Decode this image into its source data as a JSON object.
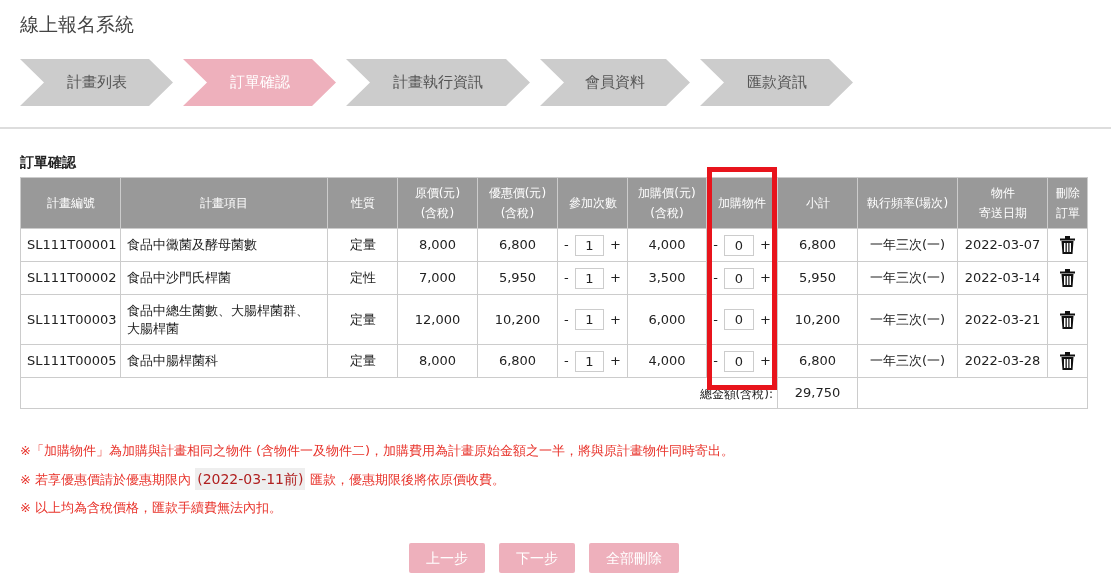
{
  "title": "線上報名系統",
  "steps": [
    {
      "label": "計畫列表",
      "selected": false
    },
    {
      "label": "訂單確認",
      "selected": true
    },
    {
      "label": "計畫執行資訊",
      "selected": false
    },
    {
      "label": "會員資料",
      "selected": false
    },
    {
      "label": "匯款資訊",
      "selected": false
    }
  ],
  "section_title": "訂單確認",
  "table": {
    "columns": [
      {
        "lines": [
          "計畫編號"
        ],
        "highlighted": false
      },
      {
        "lines": [
          "計畫項目"
        ],
        "highlighted": false
      },
      {
        "lines": [
          "性質"
        ],
        "highlighted": false
      },
      {
        "lines": [
          "原價(元)",
          "(含稅)"
        ],
        "highlighted": false
      },
      {
        "lines": [
          "優惠價(元)",
          "(含稅)"
        ],
        "highlighted": false
      },
      {
        "lines": [
          "參加次數"
        ],
        "highlighted": false
      },
      {
        "lines": [
          "加購價(元)",
          "(含稅)"
        ],
        "highlighted": false
      },
      {
        "lines": [
          "加購物件"
        ],
        "highlighted": true
      },
      {
        "lines": [
          "小計"
        ],
        "highlighted": false
      },
      {
        "lines": [
          "執行頻率(場次)"
        ],
        "highlighted": false
      },
      {
        "lines": [
          "物件",
          "寄送日期"
        ],
        "highlighted": false
      },
      {
        "lines": [
          "刪除",
          "訂單"
        ],
        "highlighted": false
      }
    ],
    "rows": [
      {
        "code": "SL111T00001",
        "item": "食品中黴菌及酵母菌數",
        "type": "定量",
        "price": "8,000",
        "discount": "6,800",
        "times": {
          "minus": "-",
          "value": "1",
          "plus": "+"
        },
        "addon_price": "4,000",
        "addon": {
          "minus": "-",
          "value": "0",
          "plus": "+"
        },
        "subtotal": "6,800",
        "frequency": "一年三次(一)",
        "ship_date": "2022-03-07"
      },
      {
        "code": "SL111T00002",
        "item": "食品中沙門氏桿菌",
        "type": "定性",
        "price": "7,000",
        "discount": "5,950",
        "times": {
          "minus": "-",
          "value": "1",
          "plus": "+"
        },
        "addon_price": "3,500",
        "addon": {
          "minus": "-",
          "value": "0",
          "plus": "+"
        },
        "subtotal": "5,950",
        "frequency": "一年三次(一)",
        "ship_date": "2022-03-14"
      },
      {
        "code": "SL111T00003",
        "item": "食品中總生菌數、大腸桿菌群、大腸桿菌",
        "type": "定量",
        "price": "12,000",
        "discount": "10,200",
        "times": {
          "minus": "-",
          "value": "1",
          "plus": "+"
        },
        "addon_price": "6,000",
        "addon": {
          "minus": "-",
          "value": "0",
          "plus": "+"
        },
        "subtotal": "10,200",
        "frequency": "一年三次(一)",
        "ship_date": "2022-03-21"
      },
      {
        "code": "SL111T00005",
        "item": "食品中腸桿菌科",
        "type": "定量",
        "price": "8,000",
        "discount": "6,800",
        "times": {
          "minus": "-",
          "value": "1",
          "plus": "+"
        },
        "addon_price": "4,000",
        "addon": {
          "minus": "-",
          "value": "0",
          "plus": "+"
        },
        "subtotal": "6,800",
        "frequency": "一年三次(一)",
        "ship_date": "2022-03-28"
      }
    ],
    "total_label": "總金額(含稅):",
    "total": "29,750"
  },
  "notes": [
    {
      "parts": [
        "※「加購物件」為加購與計畫相同之物件 (含物件一及物件二)，加購費用為計畫原始金額之一半，將與原計畫物件同時寄出。"
      ]
    },
    {
      "parts": [
        "※ 若享優惠價請於優惠期限內 ",
        "(2022-03-11前)",
        " 匯款，優惠期限後將依原價收費。"
      ]
    },
    {
      "parts": [
        "※ 以上均為含稅價格，匯款手續費無法內扣。"
      ]
    }
  ],
  "buttons": [
    "上一步",
    "下一步",
    "全部刪除"
  ]
}
